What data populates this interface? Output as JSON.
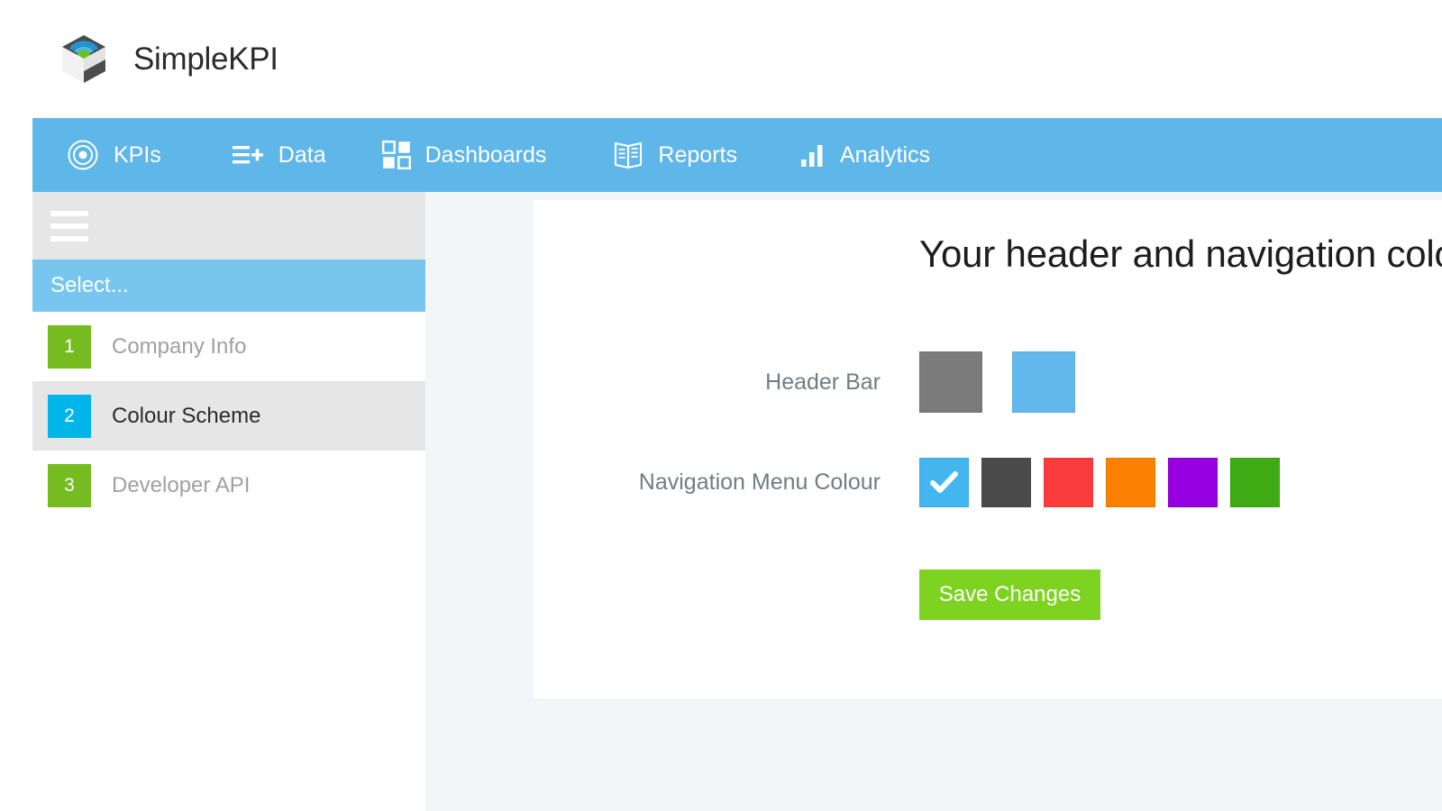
{
  "brand": {
    "name": "SimpleKPI",
    "logo_icon": "isometric-cube-logo"
  },
  "nav": {
    "background": "#5fb6e8",
    "items": [
      {
        "label": "KPIs",
        "icon": "target-icon"
      },
      {
        "label": "Data",
        "icon": "list-plus-icon"
      },
      {
        "label": "Dashboards",
        "icon": "grid-icon"
      },
      {
        "label": "Reports",
        "icon": "open-book-icon"
      },
      {
        "label": "Analytics",
        "icon": "bar-chart-icon"
      }
    ]
  },
  "sidebar": {
    "toggle_icon": "hamburger-icon",
    "select_label": "Select...",
    "steps": [
      {
        "number": "1",
        "label": "Company Info",
        "badge_color": "#76bc21",
        "active": false
      },
      {
        "number": "2",
        "label": "Colour Scheme",
        "badge_color": "#00b5e8",
        "active": true
      },
      {
        "number": "3",
        "label": "Developer API",
        "badge_color": "#76bc21",
        "active": false
      }
    ]
  },
  "main": {
    "title": "Your header and navigation colours",
    "fields": [
      {
        "label": "Header Bar",
        "swatches": [
          {
            "color": "#7b7b7b",
            "selected": false
          },
          {
            "color": "#62b8ec",
            "selected": false
          }
        ]
      },
      {
        "label": "Navigation Menu Colour",
        "swatches": [
          {
            "color": "#43b5ef",
            "selected": true
          },
          {
            "color": "#4a4a4a",
            "selected": false
          },
          {
            "color": "#f93b3b",
            "selected": false
          },
          {
            "color": "#f98000",
            "selected": false
          },
          {
            "color": "#9600e0",
            "selected": false
          },
          {
            "color": "#3fab14",
            "selected": false
          }
        ]
      }
    ],
    "save_label": "Save Changes",
    "save_color": "#7ed321",
    "check_icon": "checkmark-icon"
  }
}
